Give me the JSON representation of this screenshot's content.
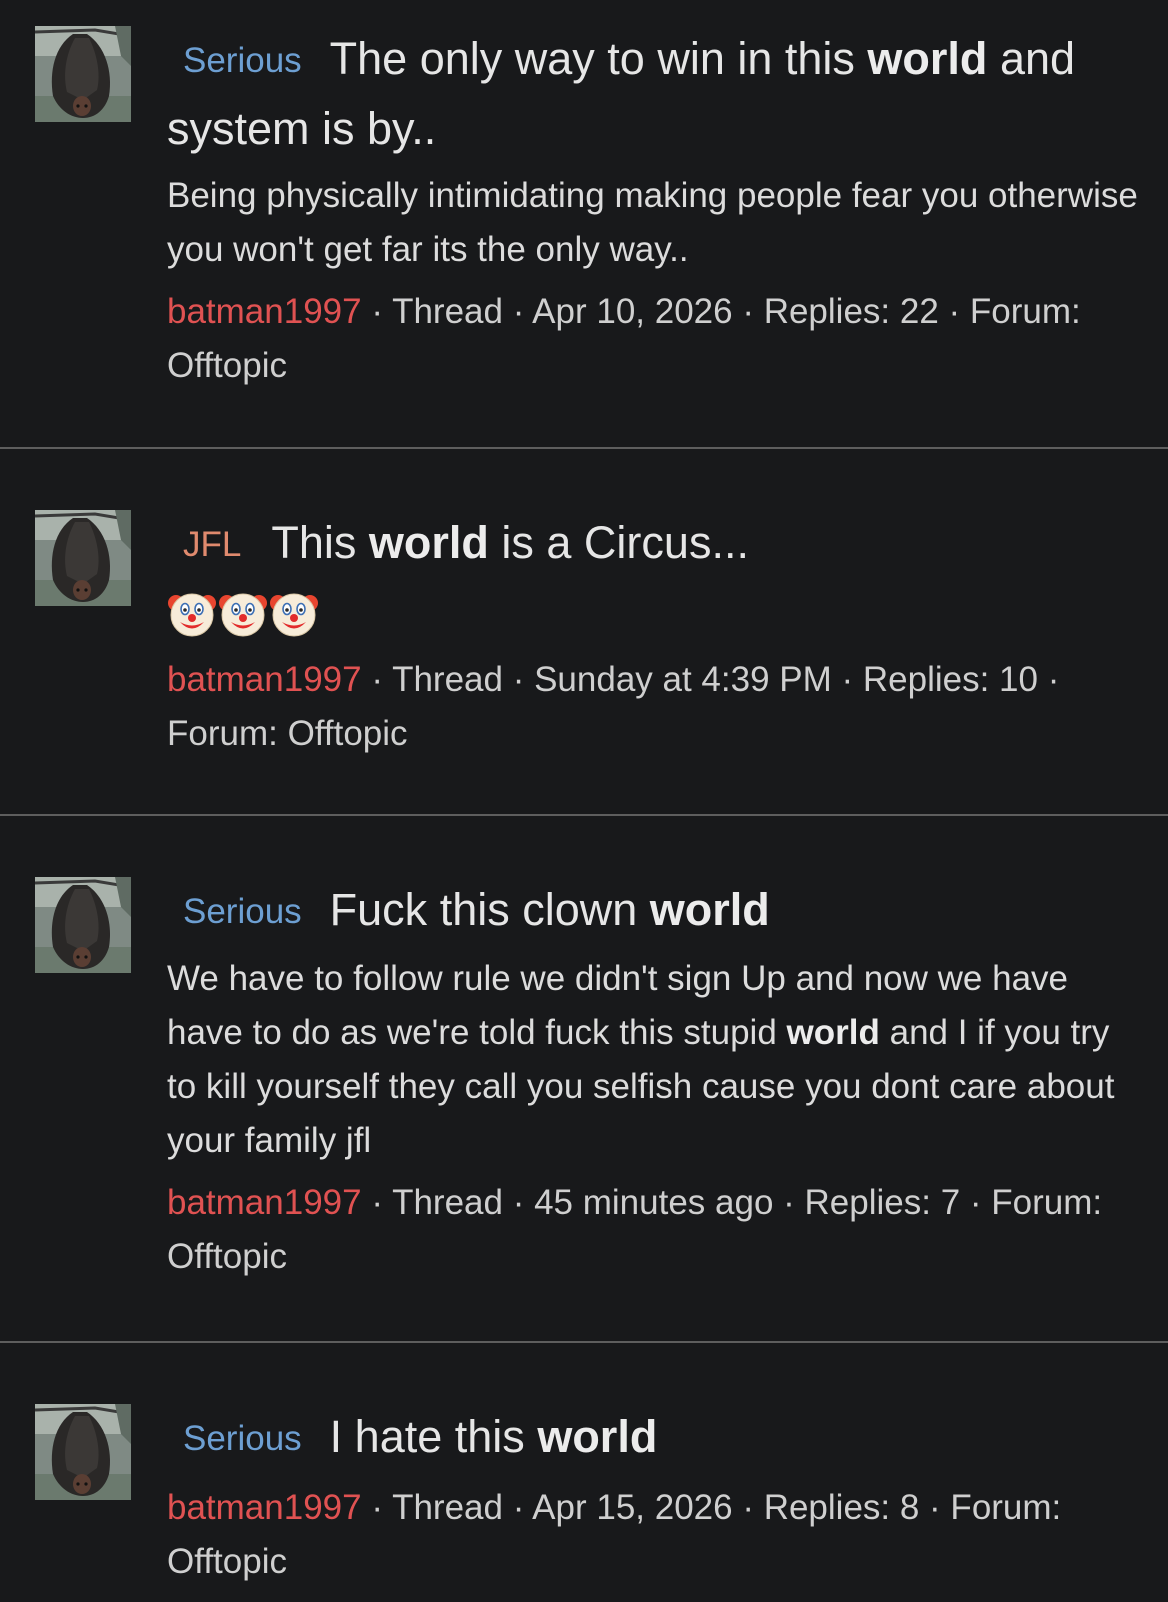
{
  "results": [
    {
      "prefix": "Serious",
      "title_pre": "The only way to win in this",
      "title_hl": "world",
      "title_post": "and system is by..",
      "snippet_pre": "Being physically intimidating making people fear you otherwise you won't get far its the only way..",
      "author": "batman1997",
      "meta": "· Thread · Apr 10, 2026 · Replies: 22 · Forum: Offtopic"
    },
    {
      "prefix": "JFL",
      "title_pre": "This",
      "title_hl": "world",
      "title_post": "is a Circus...",
      "emoji": [
        "clown-face-icon",
        "clown-face-icon",
        "clown-face-icon"
      ],
      "author": "batman1997",
      "meta": "· Thread · Sunday at 4:39 PM · Replies: 10 · Forum: Offtopic"
    },
    {
      "prefix": "Serious",
      "title_pre": "Fuck this clown",
      "title_hl": "world",
      "title_post": "",
      "snippet_pre": "We have to follow rule we didn't sign Up and now we have have to do as we're told fuck this stupid",
      "snippet_hl": "world",
      "snippet_post": "and I if you try to kill yourself they call you selfish cause you dont care about your family jfl",
      "author": "batman1997",
      "meta": "· Thread · 45 minutes ago · Replies: 7 · Forum: Offtopic"
    },
    {
      "prefix": "Serious",
      "title_pre": "I hate this",
      "title_hl": "world",
      "title_post": "",
      "author": "batman1997",
      "meta": "· Thread · Apr 15, 2026 · Replies: 8 · Forum: Offtopic"
    }
  ],
  "colors": {
    "background": "#18191b",
    "divider": "#5e5e5e",
    "prefix_serious": "#6d9fd2",
    "prefix_jfl": "#e08a6e",
    "author": "#e05252",
    "text": "#e4e4e4"
  },
  "icons": {
    "avatar": "hanging-bat-avatar-icon"
  }
}
